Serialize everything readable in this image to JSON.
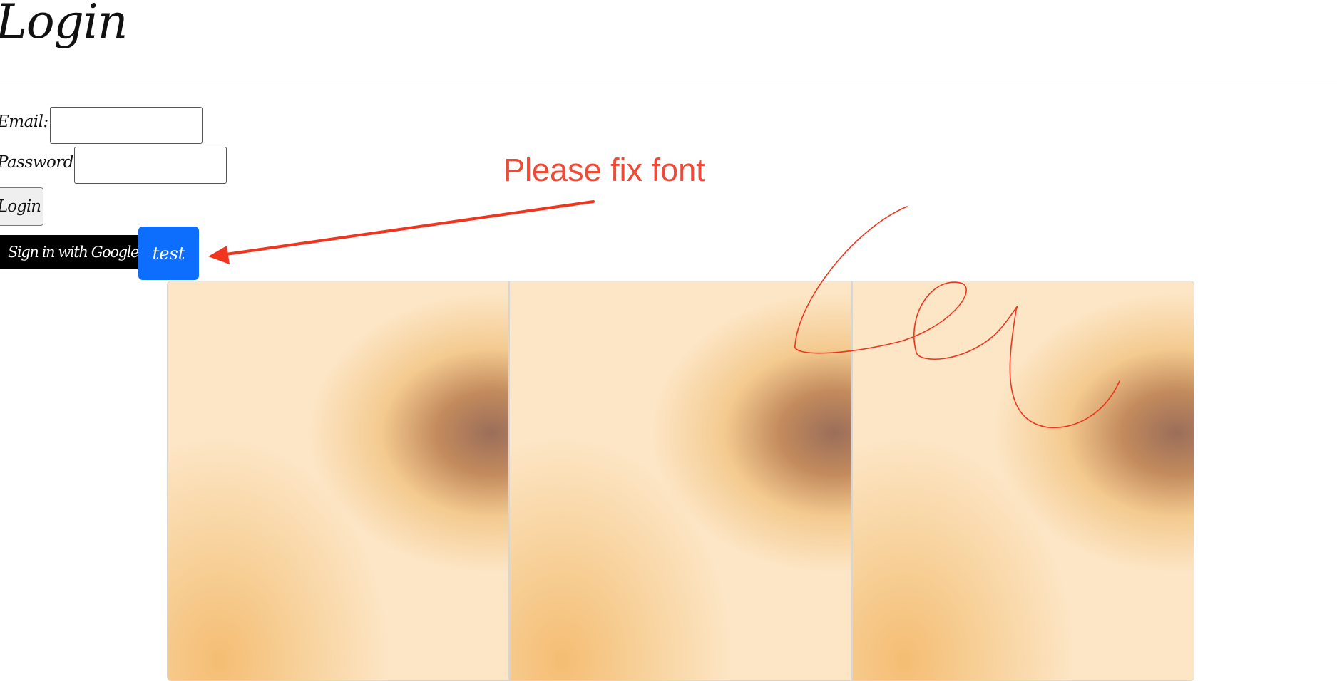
{
  "page": {
    "title": "Login"
  },
  "form": {
    "email_label": "Email:",
    "email_value": "",
    "password_label": "Password:",
    "password_value": "",
    "login_label": "Login",
    "google_label": "Sign in with Google",
    "test_label": "test"
  },
  "gallery": {
    "images": [
      {
        "alt": ""
      },
      {
        "alt": ""
      },
      {
        "alt": ""
      }
    ]
  },
  "annotation": {
    "text": "Please fix font",
    "color": "#f04a36"
  },
  "colors": {
    "test_button": "#0d6efd",
    "google_button": "#000000",
    "annotation": "#f04a36"
  }
}
